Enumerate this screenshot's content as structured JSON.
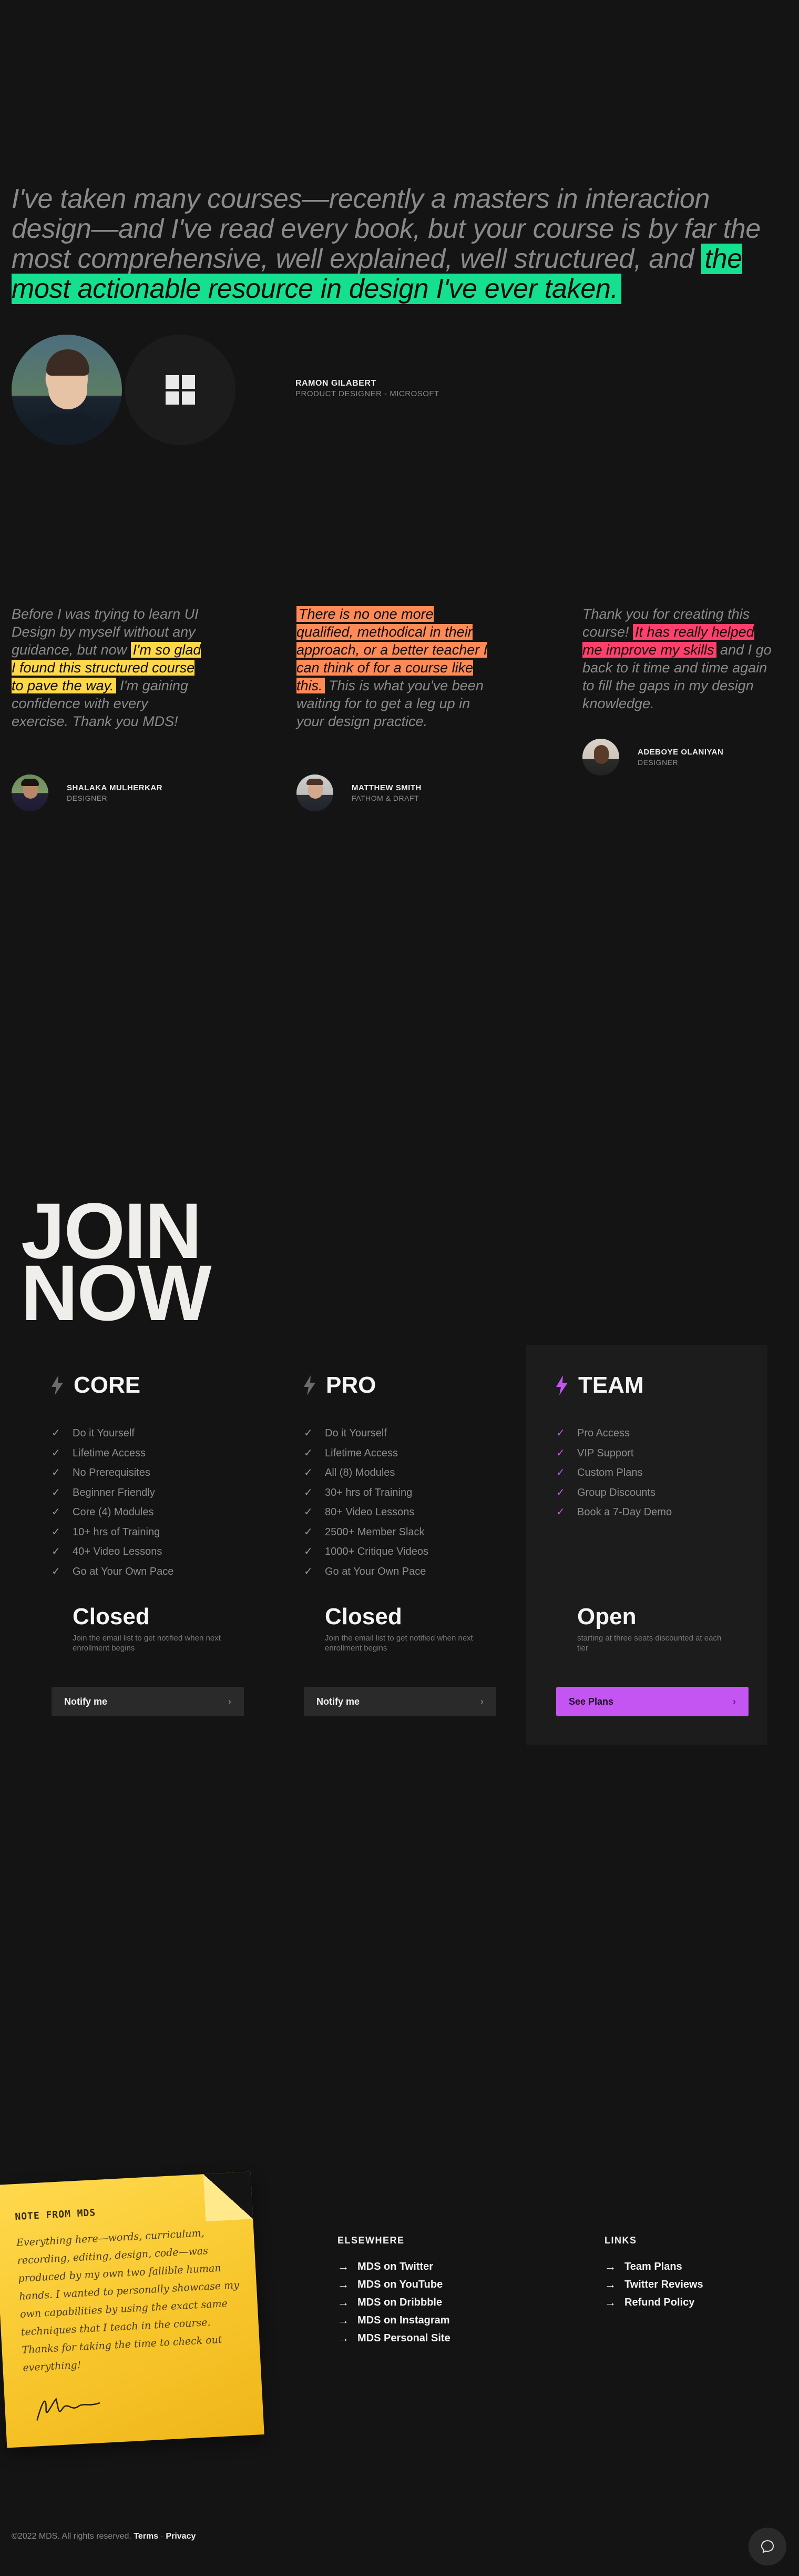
{
  "hero": {
    "quote_plain": "I've taken many courses—recently a masters in interaction design—and I've read every book, but your course is by far the most comprehensive, well explained, well structured, and ",
    "quote_highlight": "the most actionable resource in design I've ever taken.",
    "name": "RAMON GILABERT",
    "role": "PRODUCT DESIGNER - MICROSOFT"
  },
  "testimonials": [
    {
      "before": "Before I was trying to learn UI Design by myself without any guidance, but now ",
      "highlight": "I'm so glad I found this structured course to pave the way.",
      "after": " I'm gaining confidence with every exercise. Thank you MDS!",
      "name": "SHALAKA MULHERKAR",
      "role": "DESIGNER"
    },
    {
      "before": "",
      "highlight": "There is no one more qualified, methodical in their approach, or a better teacher I can think of for a course like this.",
      "after": " This is what you've been waiting for to get a leg up in your design practice.",
      "name": "MATTHEW SMITH",
      "role": "FATHOM & DRAFT"
    },
    {
      "before": "Thank you for creating this course! ",
      "highlight": "It has really helped me improve my skills",
      "after": " and I go back to it time and time again to fill the gaps in my design knowledge.",
      "name": "ADEBOYE OLANIYAN",
      "role": "DESIGNER"
    }
  ],
  "join": {
    "line1": "JOIN",
    "line2": "NOW"
  },
  "plans": [
    {
      "name": "CORE",
      "features": [
        "Do it Yourself",
        "Lifetime Access",
        "No Prerequisites",
        "Beginner Friendly",
        "Core (4) Modules",
        "10+ hrs of Training",
        "40+ Video Lessons",
        "Go at Your Own Pace"
      ],
      "status": "Closed",
      "sub": "Join the email list to get notified when next enrollment begins",
      "cta": "Notify me",
      "accent": "#6b6b6b"
    },
    {
      "name": "PRO",
      "features": [
        "Do it Yourself",
        "Lifetime Access",
        "All (8) Modules",
        "30+ hrs of Training",
        "80+ Video Lessons",
        "2500+ Member Slack",
        "1000+ Critique Videos",
        "Go at Your Own Pace"
      ],
      "status": "Closed",
      "sub": "Join the email list to get notified when next enrollment begins",
      "cta": "Notify me",
      "accent": "#6b6b6b"
    },
    {
      "name": "TEAM",
      "features": [
        "Pro Access",
        "VIP Support",
        "Custom Plans",
        "Group Discounts",
        "Book a 7-Day Demo"
      ],
      "status": "Open",
      "sub": "starting at three seats discounted at each tier",
      "cta": "See Plans",
      "accent": "#c455f2"
    }
  ],
  "note": {
    "title": "NOTE FROM MDS",
    "body": "Everything here—words, curriculum, recording, editing, design, code—was produced by my own two fallible human hands. I wanted to personally showcase my own capabilities by using the exact same techniques that I teach in the course. Thanks for taking the time to check out everything!"
  },
  "footer": {
    "elsewhere_title": "ELSEWHERE",
    "elsewhere": [
      "MDS on Twitter",
      "MDS on YouTube",
      "MDS on Dribbble",
      "MDS on Instagram",
      "MDS Personal Site"
    ],
    "links_title": "LINKS",
    "links": [
      "Team Plans",
      "Twitter Reviews",
      "Refund Policy"
    ],
    "copyright": "©2022 MDS. All rights reserved.",
    "terms": "Terms",
    "dot": "·",
    "privacy": "Privacy"
  }
}
